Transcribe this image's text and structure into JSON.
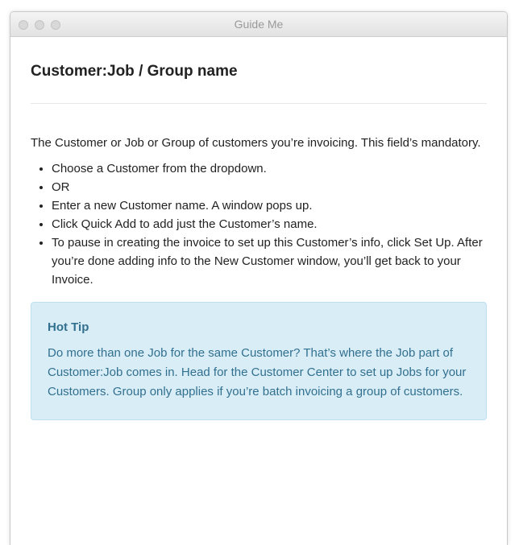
{
  "window": {
    "title": "Guide Me"
  },
  "heading": "Customer:Job / Group name",
  "description": "The Customer or Job or Group of customers you’re invoicing. This field’s mandatory.",
  "bullets": [
    "Choose a Customer from the dropdown.",
    "OR",
    "Enter a new Customer name. A window pops up.",
    "Click Quick Add to add just the Customer’s name.",
    "To pause in creating the invoice to set up this Customer’s info, click Set Up. After you’re done adding info to the New Customer window, you’ll get back to your Invoice."
  ],
  "hot_tip": {
    "title": "Hot Tip",
    "body": "Do more than one Job for the same Customer? That’s where the Job part of Customer:Job comes in. Head for the Customer Center to set up Jobs for your Customers. Group only applies if you’re batch invoicing a group of customers."
  },
  "colors": {
    "tip_background": "#d9edf7",
    "tip_text": "#31708f"
  }
}
